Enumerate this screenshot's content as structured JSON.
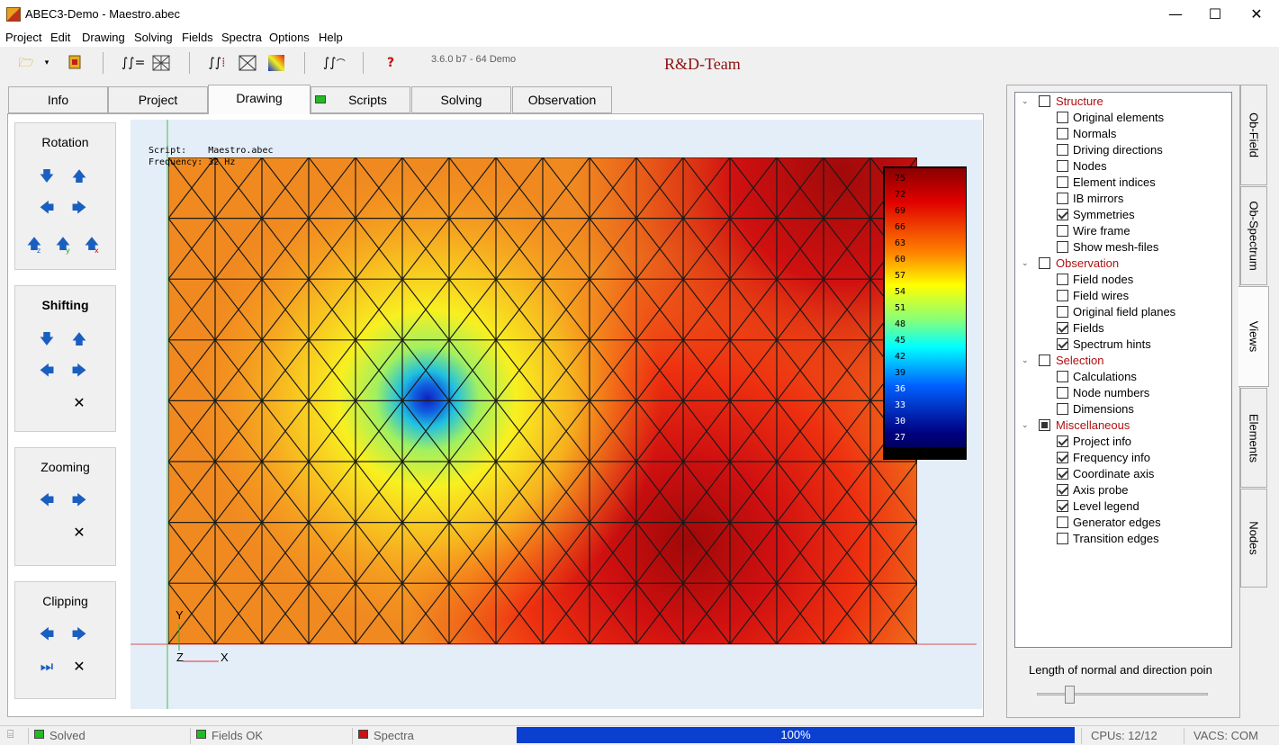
{
  "window": {
    "title": "ABEC3-Demo - Maestro.abec",
    "minimize_glyph": "—",
    "maximize_glyph": "☐",
    "close_glyph": "✕"
  },
  "menu": [
    "Project",
    "Edit",
    "Drawing",
    "Solving",
    "Fields",
    "Spectra",
    "Options",
    "Help"
  ],
  "toolbar": {
    "version": "3.6.0 b7 - 64 Demo",
    "team": "R&D-Team",
    "icons": [
      "open-folder-icon",
      "dropdown-arrow-icon",
      "save-project-icon",
      "integral-solve-icon",
      "mesh-grid-icon",
      "integral-fields-icon",
      "field-mesh-icon",
      "color-map-icon",
      "integral-spectra-icon",
      "help-icon"
    ]
  },
  "tabs": [
    {
      "label": "Info",
      "active": false
    },
    {
      "label": "Project",
      "active": false
    },
    {
      "label": "Drawing",
      "active": true
    },
    {
      "label": "Scripts",
      "active": false,
      "indicator": "#22bb22"
    },
    {
      "label": "Solving",
      "active": false
    },
    {
      "label": "Observation",
      "active": false
    }
  ],
  "controls": {
    "rotation": {
      "title": "Rotation",
      "axis_buttons": [
        "z",
        "y",
        "x"
      ]
    },
    "shifting": {
      "title": "Shifting"
    },
    "zooming": {
      "title": "Zooming"
    },
    "clipping": {
      "title": "Clipping"
    }
  },
  "canvas": {
    "script_label": "Script:",
    "script_value": "Maestro.abec",
    "frequency_label": "Frequency:",
    "frequency_value": "32 Hz",
    "axis_y": "Y",
    "axis_z": "Z",
    "axis_x": "X"
  },
  "legend": {
    "levels": [
      "75",
      "72",
      "69",
      "66",
      "63",
      "60",
      "57",
      "54",
      "51",
      "48",
      "45",
      "42",
      "39",
      "36",
      "33",
      "30",
      "27"
    ]
  },
  "tree": [
    {
      "label": "Structure",
      "type": "category",
      "checked": false,
      "expand": "⌄"
    },
    {
      "label": "Original elements",
      "checked": false
    },
    {
      "label": "Normals",
      "checked": false
    },
    {
      "label": "Driving directions",
      "checked": false
    },
    {
      "label": "Nodes",
      "checked": false
    },
    {
      "label": "Element indices",
      "checked": false
    },
    {
      "label": "IB mirrors",
      "checked": false
    },
    {
      "label": "Symmetries",
      "checked": true
    },
    {
      "label": "Wire frame",
      "checked": false
    },
    {
      "label": "Show mesh-files",
      "checked": false
    },
    {
      "label": "Observation",
      "type": "category",
      "checked": false,
      "expand": "⌄"
    },
    {
      "label": "Field nodes",
      "checked": false
    },
    {
      "label": "Field wires",
      "checked": false
    },
    {
      "label": "Original field planes",
      "checked": false
    },
    {
      "label": "Fields",
      "checked": true
    },
    {
      "label": "Spectrum hints",
      "checked": true
    },
    {
      "label": "Selection",
      "type": "category",
      "checked": false,
      "expand": "⌄"
    },
    {
      "label": "Calculations",
      "checked": false
    },
    {
      "label": "Node numbers",
      "checked": false
    },
    {
      "label": "Dimensions",
      "checked": false
    },
    {
      "label": "Miscellaneous",
      "type": "category",
      "checked": "partial",
      "expand": "⌄"
    },
    {
      "label": "Project info",
      "checked": true
    },
    {
      "label": "Frequency info",
      "checked": true
    },
    {
      "label": "Coordinate axis",
      "checked": true
    },
    {
      "label": "Axis probe",
      "checked": true
    },
    {
      "label": "Level legend",
      "checked": true
    },
    {
      "label": "Generator edges",
      "checked": false
    },
    {
      "label": "Transition edges",
      "checked": false
    }
  ],
  "side_tabs": [
    {
      "label": "Ob-Field",
      "active": false
    },
    {
      "label": "Ob-Spectrum",
      "active": false
    },
    {
      "label": "Views",
      "active": true
    },
    {
      "label": "Elements",
      "active": false
    },
    {
      "label": "Nodes",
      "active": false
    }
  ],
  "slider": {
    "label": "Length of normal and direction poin",
    "value": 0.2
  },
  "status": {
    "solved": "Solved",
    "fields": "Fields OK",
    "spectra": "Spectra",
    "progress": "100%",
    "progress_value": 1.0,
    "cpus": "CPUs: 12/12",
    "vacs": "VACS: COM",
    "colors": {
      "ok": "#22bb22",
      "error": "#cc1111",
      "progress": "#0a3fcf"
    }
  }
}
